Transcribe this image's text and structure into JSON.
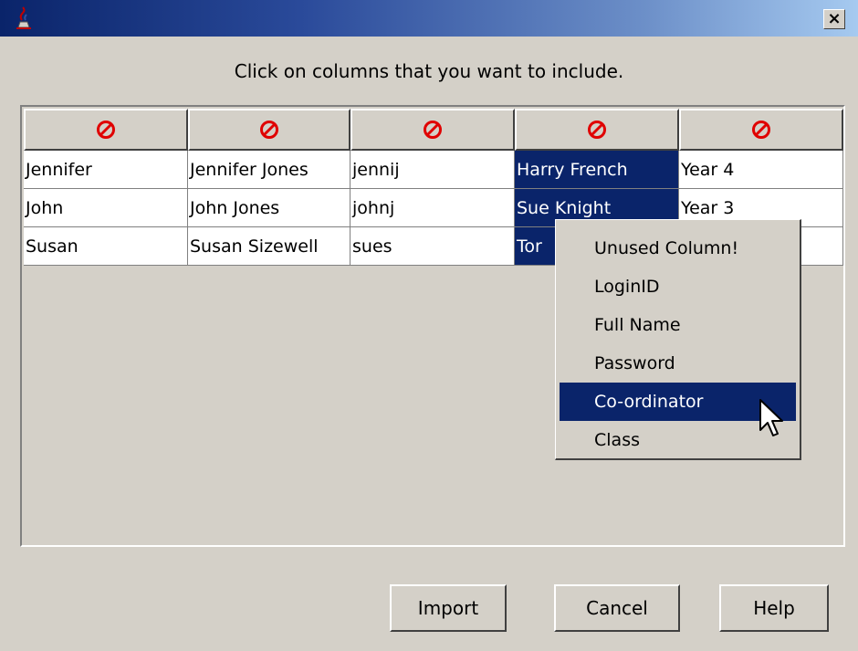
{
  "window": {
    "close_label": "×",
    "icons": {
      "app": "java-coffee-icon",
      "close": "close-icon"
    }
  },
  "instruction": "Click on columns that you want to include.",
  "table": {
    "header_icon": "prohibited-icon",
    "header_icon_color": "#e00000",
    "rows": [
      [
        "Jennifer",
        "Jennifer Jones",
        "jennij",
        "Harry French",
        "Year 4"
      ],
      [
        "John",
        "John Jones",
        "johnj",
        "Sue Knight",
        "Year 3"
      ],
      [
        "Susan",
        "Susan Sizewell",
        "sues",
        "Tor",
        ""
      ]
    ],
    "selected_column": 3,
    "selection_color": "#0a246a"
  },
  "context_menu": {
    "items": [
      "Unused Column!",
      "LoginID",
      "Full Name",
      "Password",
      "Co-ordinator",
      "Class"
    ],
    "highlighted": "Co-ordinator"
  },
  "buttons": {
    "import": "Import",
    "cancel": "Cancel",
    "help": "Help"
  }
}
